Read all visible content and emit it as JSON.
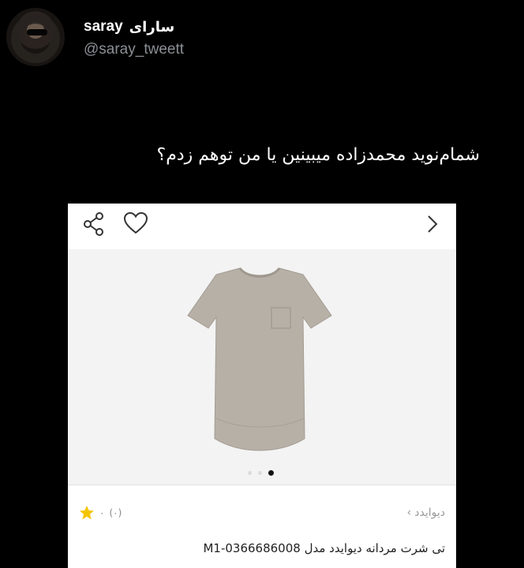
{
  "tweet": {
    "author_name_en": "saray",
    "author_name_fa": "سارای",
    "handle": "@saray_tweett",
    "text": "شمام‌نوید محمدزاده میبینین یا من توهم زدم؟"
  },
  "product_card": {
    "brand": "دیوایدد",
    "brand_chevron": "›",
    "rating_value": "۰",
    "rating_count": "(۰)",
    "title": "تی شرت مردانه دیوایدد مدل M1-0366686008",
    "carousel": {
      "total": 3,
      "active_index": 2
    },
    "colors": {
      "shirt": "#b7b0a7",
      "star": "#f5c400"
    }
  }
}
